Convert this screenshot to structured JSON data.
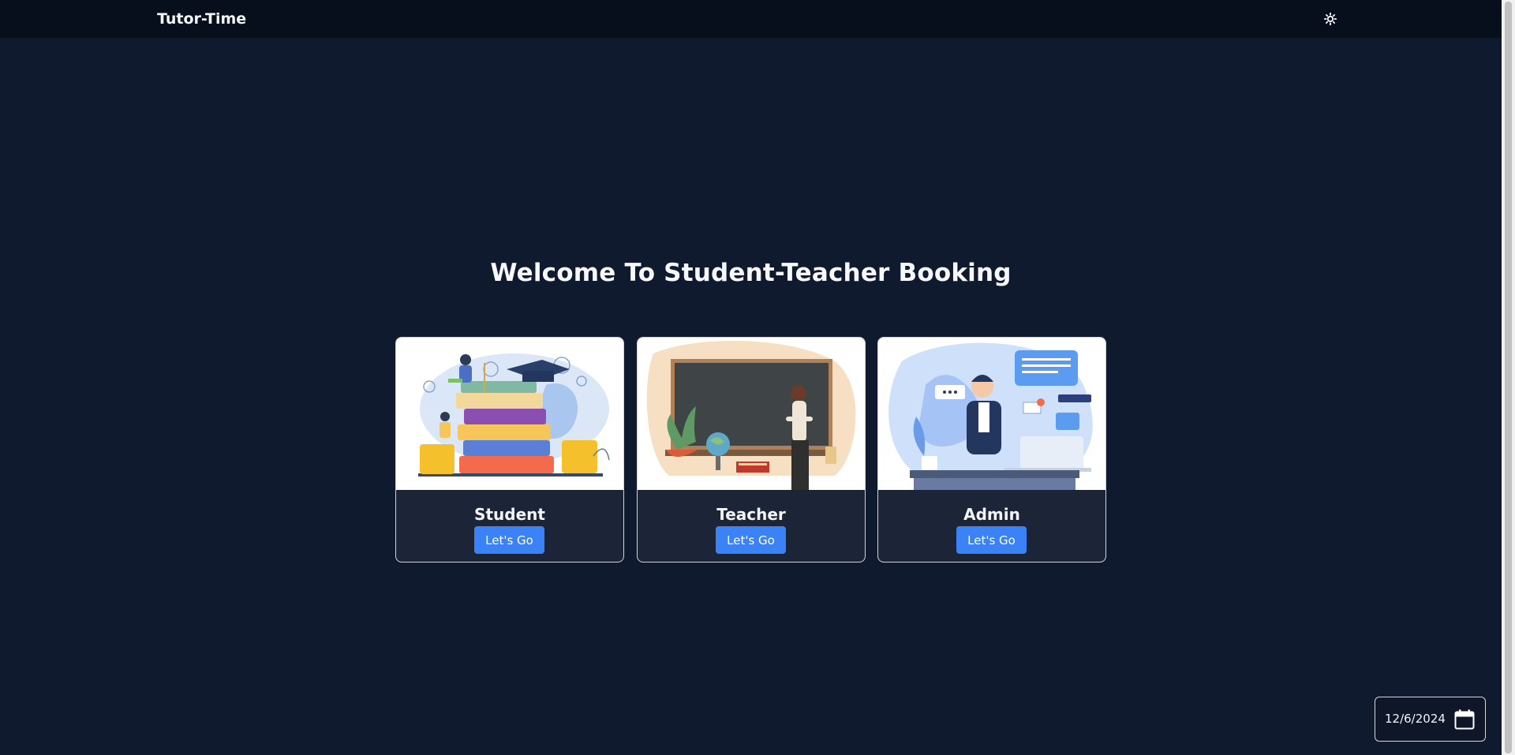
{
  "nav": {
    "brand": "Tutor-Time",
    "theme_icon": "gear-sun-icon"
  },
  "page": {
    "title": "Welcome To Student-Teacher Booking"
  },
  "cards": [
    {
      "title": "Student",
      "button": "Let's Go",
      "image": "student-illustration"
    },
    {
      "title": "Teacher",
      "button": "Let's Go",
      "image": "teacher-illustration"
    },
    {
      "title": "Admin",
      "button": "Let's Go",
      "image": "admin-illustration"
    }
  ],
  "date_widget": {
    "value": "12/6/2024",
    "icon": "calendar-icon"
  },
  "colors": {
    "background": "#101a2e",
    "navbar": "#070e1c",
    "card_footer": "#1c2537",
    "button": "#3b82f6"
  }
}
